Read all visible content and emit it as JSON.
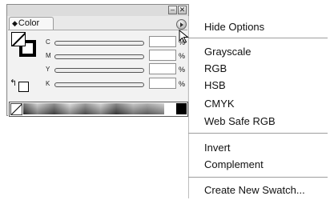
{
  "panel": {
    "tab_label": "Color",
    "channels": [
      {
        "label": "C",
        "value": "",
        "unit": "%"
      },
      {
        "label": "M",
        "value": "",
        "unit": "%"
      },
      {
        "label": "Y",
        "value": "",
        "unit": "%"
      },
      {
        "label": "K",
        "value": "",
        "unit": "%"
      }
    ]
  },
  "menu": {
    "hide_options": "Hide Options",
    "grayscale": "Grayscale",
    "rgb": "RGB",
    "hsb": "HSB",
    "cmyk": "CMYK",
    "web_safe_rgb": "Web Safe RGB",
    "invert": "Invert",
    "complement": "Complement",
    "create_new_swatch": "Create New Swatch..."
  },
  "icons": {
    "minimize": "minimize-icon",
    "close": "close-icon",
    "panel_menu": "panel-menu-icon",
    "cursor": "cursor-icon"
  }
}
